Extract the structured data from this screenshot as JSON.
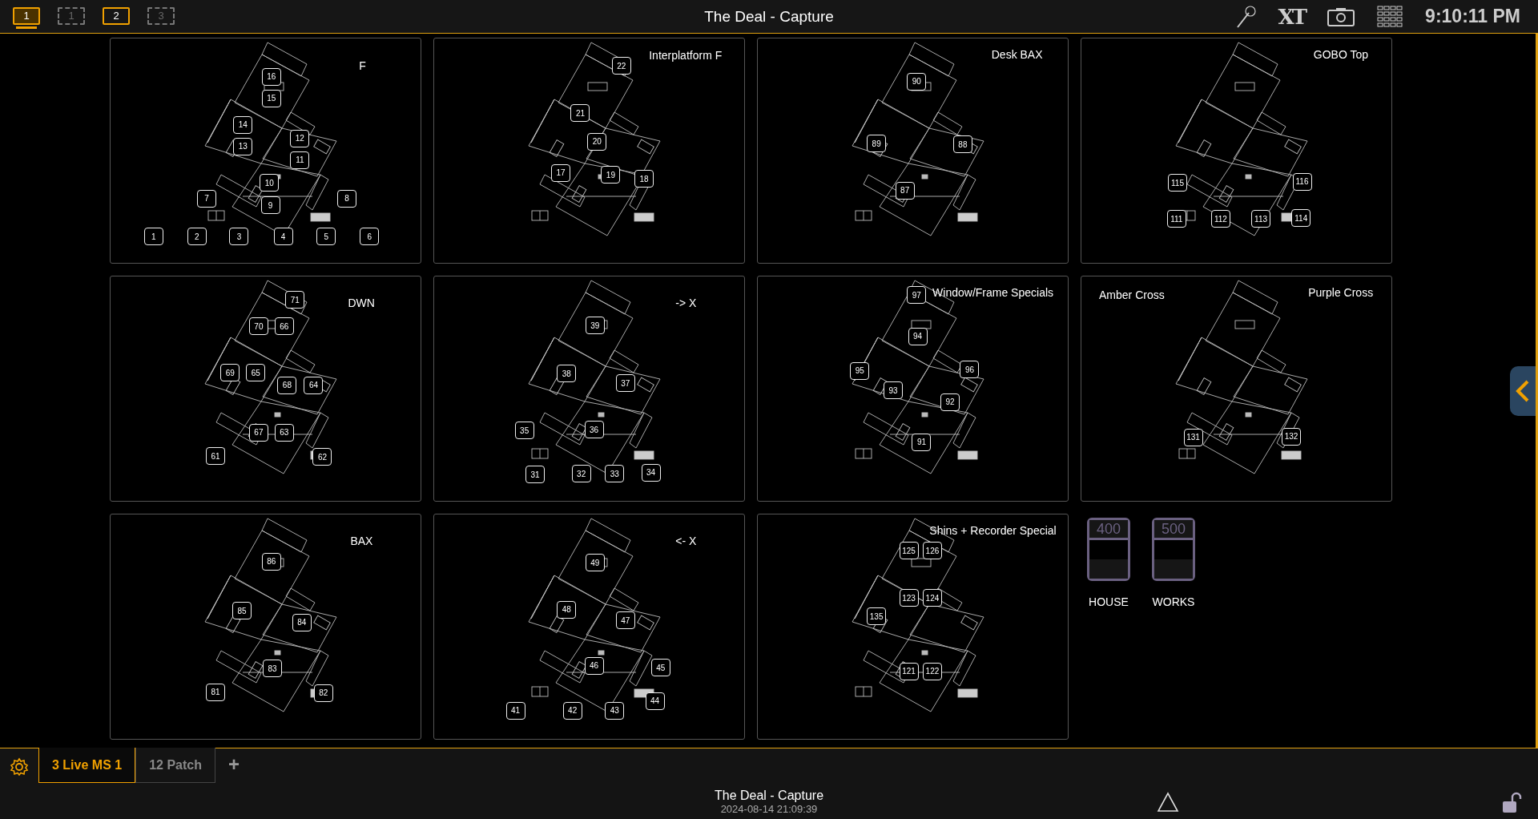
{
  "top_bar": {
    "screens": [
      {
        "label": "1",
        "selected": true,
        "active": true
      },
      {
        "label": "1",
        "selected": false,
        "active": false
      },
      {
        "label": "2",
        "selected": false,
        "active": true
      },
      {
        "label": "3",
        "selected": false,
        "active": false
      }
    ],
    "title": "The Deal - Capture",
    "logo": "XT",
    "time": "9:10:11 PM"
  },
  "panels": [
    {
      "labels": [
        "F"
      ],
      "channels": [
        "16",
        "15",
        "14",
        "13",
        "12",
        "11",
        "10",
        "9",
        "7",
        "8",
        "1",
        "2",
        "3",
        "4",
        "5",
        "6"
      ]
    },
    {
      "labels": [
        "Interplatform F"
      ],
      "channels": [
        "22",
        "21",
        "20",
        "17",
        "19",
        "18"
      ]
    },
    {
      "labels": [
        "Desk BAX"
      ],
      "channels": [
        "90",
        "89",
        "88",
        "87"
      ]
    },
    {
      "labels": [
        "GOBO Top"
      ],
      "channels": [
        "115",
        "116",
        "111",
        "112",
        "113",
        "114"
      ]
    },
    {
      "labels": [
        "DWN"
      ],
      "channels": [
        "71",
        "70",
        "66",
        "69",
        "65",
        "68",
        "64",
        "67",
        "63",
        "61",
        "62"
      ]
    },
    {
      "labels": [
        "-> X"
      ],
      "channels": [
        "39",
        "38",
        "37",
        "35",
        "36",
        "31",
        "32",
        "33",
        "34"
      ]
    },
    {
      "labels": [
        "Window/Frame Specials"
      ],
      "channels": [
        "97",
        "94",
        "95",
        "96",
        "93",
        "92",
        "91"
      ]
    },
    {
      "labels": [
        "Amber Cross",
        "Purple Cross"
      ],
      "channels": [
        "131",
        "132"
      ]
    },
    {
      "labels": [
        "BAX"
      ],
      "channels": [
        "86",
        "85",
        "84",
        "83",
        "81",
        "82"
      ]
    },
    {
      "labels": [
        "<- X"
      ],
      "channels": [
        "49",
        "48",
        "47",
        "46",
        "45",
        "44",
        "41",
        "42",
        "43"
      ]
    },
    {
      "labels": [
        "Shins + Recorder Special"
      ],
      "channels": [
        "125",
        "126",
        "123",
        "124",
        "135",
        "121",
        "122"
      ]
    }
  ],
  "submasters": [
    {
      "number": "400",
      "label": "HOUSE"
    },
    {
      "number": "500",
      "label": "WORKS"
    }
  ],
  "bottom_bar": {
    "tabs": [
      {
        "label": "3 Live MS 1",
        "selected": true
      },
      {
        "label": "12 Patch",
        "selected": false
      }
    ],
    "add_tab": "+",
    "show_name": "The Deal - Capture",
    "timestamp": "2024-08-14 21:09:39"
  }
}
